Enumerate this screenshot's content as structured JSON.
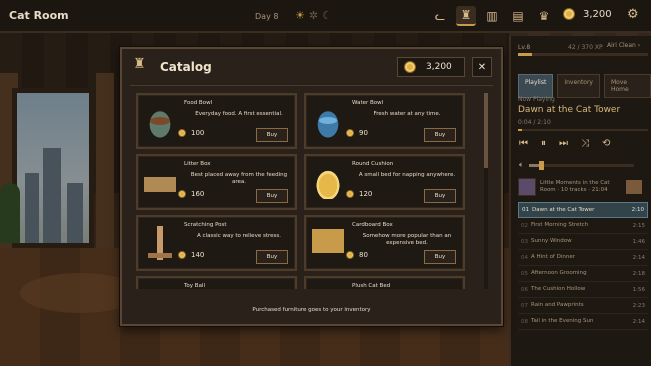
{
  "topbar": {
    "room_title": "Cat Room",
    "day": "Day 8",
    "coins": "3,200"
  },
  "icons": {
    "weather": [
      "sun-icon",
      "sparkle-icon",
      "moon-icon"
    ],
    "nav": [
      "cat-icon",
      "cat-tree-icon",
      "book-icon",
      "clipboard-icon",
      "trophy-icon"
    ],
    "currency": "coin-icon",
    "settings": "gear-icon"
  },
  "catalog": {
    "title": "Catalog",
    "coins": "3,200",
    "close_label": "✕",
    "footer": "Purchased furniture goes to your inventory",
    "items": [
      {
        "name": "Food Bowl",
        "desc": "Everyday food. A first essential.",
        "price": "100",
        "buy": "Buy"
      },
      {
        "name": "Water Bowl",
        "desc": "Fresh water at any time.",
        "price": "90",
        "buy": "Buy"
      },
      {
        "name": "Litter Box",
        "desc": "Best placed away from the feeding area.",
        "price": "160",
        "buy": "Buy"
      },
      {
        "name": "Round Cushion",
        "desc": "A small bed for napping anywhere.",
        "price": "120",
        "buy": "Buy"
      },
      {
        "name": "Scratching Post",
        "desc": "A classic way to relieve stress.",
        "price": "140",
        "buy": "Buy"
      },
      {
        "name": "Cardboard Box",
        "desc": "Somehow more popular than an expensive bed.",
        "price": "80",
        "buy": "Buy"
      },
      {
        "name": "Toy Ball",
        "desc": "",
        "price": "",
        "buy": ""
      },
      {
        "name": "Plush Cat Bed",
        "desc": "",
        "price": "",
        "buy": ""
      }
    ]
  },
  "music": {
    "level": "Lv.8",
    "xp": "42 / 370 XP",
    "xp_fraction": 0.11,
    "room_select": "Airi Clean ›",
    "tabs": [
      "Playlist",
      "Inventory",
      "Move Home"
    ],
    "now_playing_label": "Now Playing",
    "now_playing_title": "Dawn at the Cat Tower",
    "time": "0:04 / 2:10",
    "progress_fraction": 0.03,
    "album_text": "Little Moments in the Cat Room · 10 tracks · 21:04",
    "tracks": [
      {
        "n": "01",
        "title": "Dawn at the Cat Tower",
        "dur": "2:10"
      },
      {
        "n": "02",
        "title": "First Morning Stretch",
        "dur": "2:15"
      },
      {
        "n": "03",
        "title": "Sunny Window",
        "dur": "1:46"
      },
      {
        "n": "04",
        "title": "A Hint of Dinner",
        "dur": "2:14"
      },
      {
        "n": "05",
        "title": "Afternoon Grooming",
        "dur": "2:18"
      },
      {
        "n": "06",
        "title": "The Cushion Hollow",
        "dur": "1:56"
      },
      {
        "n": "07",
        "title": "Rain and Pawprints",
        "dur": "2:23"
      },
      {
        "n": "08",
        "title": "Tail in the Evening Sun",
        "dur": "2:14"
      }
    ]
  }
}
